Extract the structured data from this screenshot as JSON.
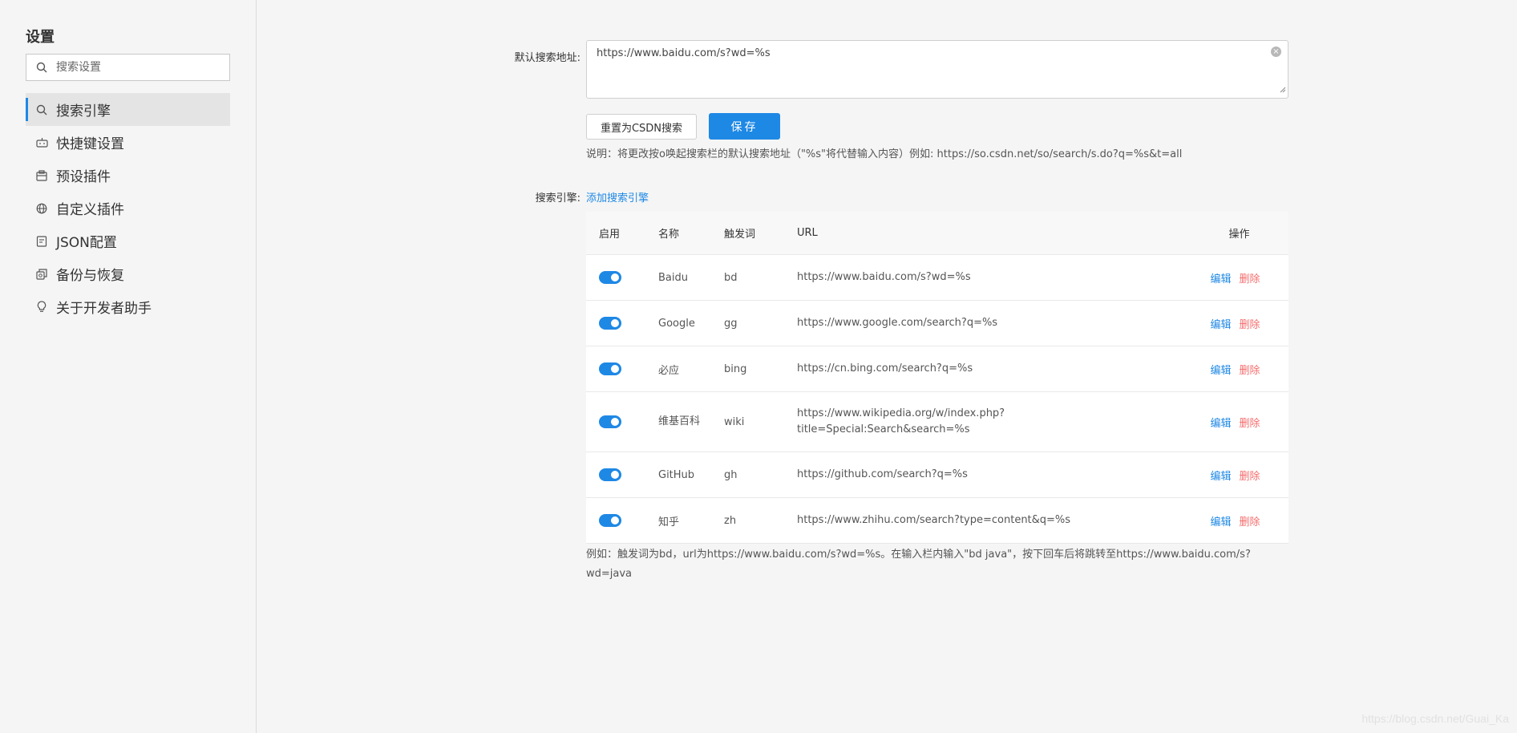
{
  "sidebar": {
    "title": "设置",
    "search_placeholder": "搜索设置",
    "items": [
      {
        "label": "搜索引擎",
        "icon": "search-icon"
      },
      {
        "label": "快捷键设置",
        "icon": "keyboard-icon"
      },
      {
        "label": "预设插件",
        "icon": "package-icon"
      },
      {
        "label": "自定义插件",
        "icon": "globe-icon"
      },
      {
        "label": "JSON配置",
        "icon": "file-json-icon"
      },
      {
        "label": "备份与恢复",
        "icon": "backup-icon"
      },
      {
        "label": "关于开发者助手",
        "icon": "lightbulb-icon"
      }
    ]
  },
  "main": {
    "default_label": "默认搜索地址:",
    "default_url": "https://www.baidu.com/s?wd=%s",
    "reset_button": "重置为CSDN搜索",
    "save_button": "保存",
    "note": "说明：将更改按o唤起搜索栏的默认搜索地址（\"%s\"将代替输入内容）例如: https://so.csdn.net/so/search/s.do?q=%s&t=all",
    "engines_label": "搜索引擎:",
    "add_link": "添加搜索引擎",
    "table": {
      "headers": {
        "enabled": "启用",
        "name": "名称",
        "trigger": "触发词",
        "url": "URL",
        "actions": "操作"
      },
      "edit_label": "编辑",
      "delete_label": "删除",
      "rows": [
        {
          "enabled": true,
          "name": "Baidu",
          "trigger": "bd",
          "url": "https://www.baidu.com/s?wd=%s"
        },
        {
          "enabled": true,
          "name": "Google",
          "trigger": "gg",
          "url": "https://www.google.com/search?q=%s"
        },
        {
          "enabled": true,
          "name": "必应",
          "trigger": "bing",
          "url": "https://cn.bing.com/search?q=%s"
        },
        {
          "enabled": true,
          "name": "维基百科",
          "trigger": "wiki",
          "url": "https://www.wikipedia.org/w/index.php?title=Special:Search&search=%s"
        },
        {
          "enabled": true,
          "name": "GitHub",
          "trigger": "gh",
          "url": "https://github.com/search?q=%s"
        },
        {
          "enabled": true,
          "name": "知乎",
          "trigger": "zh",
          "url": "https://www.zhihu.com/search?type=content&q=%s"
        }
      ]
    },
    "example": "例如：触发词为bd，url为https://www.baidu.com/s?wd=%s。在输入栏内输入\"bd java\"，按下回车后将跳转至https://www.baidu.com/s?wd=java"
  },
  "watermark": "https://blog.csdn.net/Guai_Ka",
  "colors": {
    "accent": "#1e88e5",
    "danger": "#f56c6c"
  }
}
